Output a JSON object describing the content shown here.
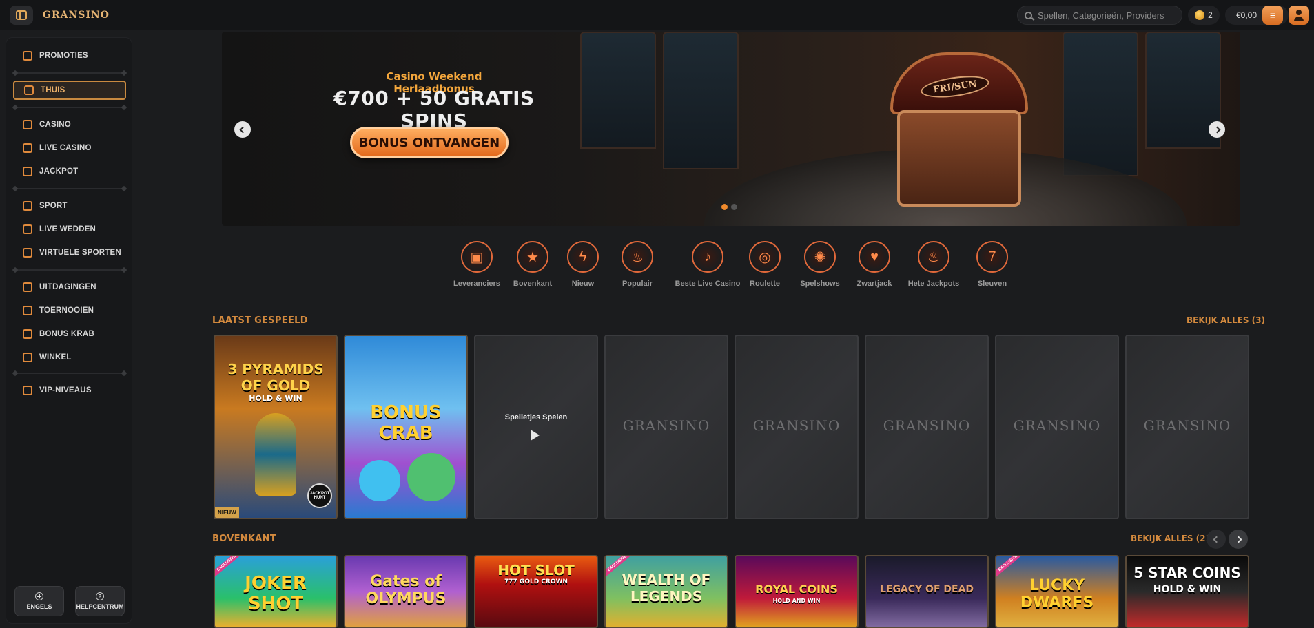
{
  "topbar": {
    "logo": "GRANSINO",
    "search_placeholder": "Spellen, Categorieën, Providers",
    "coins": "2",
    "balance": "€0,00"
  },
  "sidebar": {
    "items": [
      {
        "label": "PROMOTIES",
        "icon": "gift-icon"
      },
      {
        "label": "THUIS",
        "icon": "home-icon",
        "active": true
      },
      {
        "label": "CASINO",
        "icon": "casino-icon"
      },
      {
        "label": "LIVE CASINO",
        "icon": "microphone-icon"
      },
      {
        "label": "JACKPOT",
        "icon": "jackpot-icon"
      },
      {
        "label": "SPORT",
        "icon": "ball-icon"
      },
      {
        "label": "LIVE WEDDEN",
        "icon": "live-icon"
      },
      {
        "label": "VIRTUELE SPORTEN",
        "icon": "virtual-icon"
      },
      {
        "label": "UITDAGINGEN",
        "icon": "medal-icon"
      },
      {
        "label": "TOERNOOIEN",
        "icon": "trophy-icon"
      },
      {
        "label": "BONUS KRAB",
        "icon": "scratch-icon"
      },
      {
        "label": "WINKEL",
        "icon": "shop-icon"
      },
      {
        "label": "VIP-NIVEAUS",
        "icon": "diamond-icon"
      }
    ],
    "language_label": "ENGELS",
    "help_label": "HELPCENTRUM"
  },
  "banner": {
    "subtitle": "Casino Weekend Herlaadbonus",
    "title": "€700 + 50 GRATIS SPINS",
    "cta": "BONUS ONTVANGEN",
    "chest_text": "FRI/SUN"
  },
  "categories": [
    {
      "label": "Leveranciers",
      "icon": "provider-icon"
    },
    {
      "label": "Bovenkant",
      "icon": "star-icon"
    },
    {
      "label": "Nieuw",
      "icon": "lightning-icon"
    },
    {
      "label": "Populair",
      "icon": "flame-icon"
    },
    {
      "label": "Beste Live Casino",
      "icon": "microphone-icon"
    },
    {
      "label": "Roulette",
      "icon": "roulette-icon"
    },
    {
      "label": "Spelshows",
      "icon": "wheel-icon"
    },
    {
      "label": "Zwartjack",
      "icon": "cards-icon"
    },
    {
      "label": "Hete Jackpots",
      "icon": "hot-icon"
    },
    {
      "label": "Sleuven",
      "icon": "slot-icon"
    }
  ],
  "recent": {
    "title": "LAATST GESPEELD",
    "view_all": "BEKIJK ALLES (3)",
    "tiles": [
      {
        "type": "game",
        "name": "3 PYRAMIDS OF GOLD",
        "sub": "HOLD & WIN",
        "badge": "NIEUW",
        "stamp": "JACKPOT HUNT"
      },
      {
        "type": "game",
        "name": "BONUS CRAB"
      },
      {
        "type": "play",
        "label": "Spelletjes Spelen"
      },
      {
        "type": "placeholder",
        "logo": "GRANSINO"
      },
      {
        "type": "placeholder",
        "logo": "GRANSINO"
      },
      {
        "type": "placeholder",
        "logo": "GRANSINO"
      },
      {
        "type": "placeholder",
        "logo": "GRANSINO"
      },
      {
        "type": "placeholder",
        "logo": "GRANSINO"
      }
    ]
  },
  "top": {
    "title": "BOVENKANT",
    "view_all": "BEKIJK ALLES (217)",
    "tiles": [
      {
        "name": "JOKER SHOT",
        "ribbon": "EXCLUSIVE"
      },
      {
        "name": "Gates of OLYMPUS"
      },
      {
        "name": "HOT SLOT",
        "sub": "777 GOLD CROWN"
      },
      {
        "name": "WEALTH OF LEGENDS",
        "ribbon": "EXCLUSIVE"
      },
      {
        "name": "ROYAL COINS",
        "sub": "HOLD AND WIN"
      },
      {
        "name": "LEGACY OF DEAD"
      },
      {
        "name": "LUCKY DWARFS",
        "ribbon": "EXCLUSIVE"
      },
      {
        "name": "5 STAR COINS",
        "sub": "HOLD & WIN"
      }
    ]
  }
}
